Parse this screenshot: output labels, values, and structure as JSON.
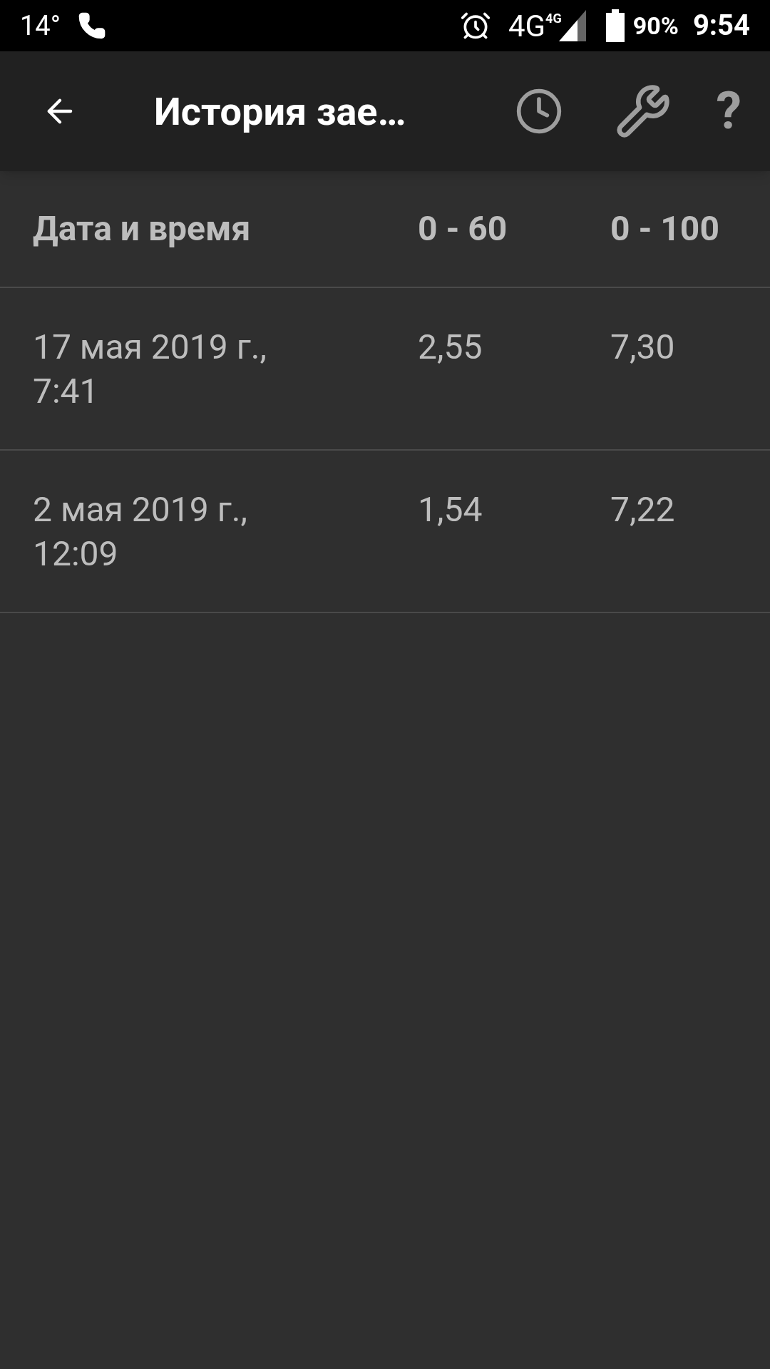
{
  "status_bar": {
    "temperature": "14°",
    "network": "4G",
    "network_small": "4G",
    "battery": "90%",
    "time": "9:54"
  },
  "toolbar": {
    "title": "История зае…",
    "help": "?"
  },
  "table": {
    "columns": [
      "Дата и время",
      "0 - 60",
      "0 - 100"
    ],
    "rows": [
      [
        "17 мая 2019 г., 7:41",
        "2,55",
        "7,30"
      ],
      [
        "2 мая 2019 г., 12:09",
        "1,54",
        "7,22"
      ]
    ]
  }
}
